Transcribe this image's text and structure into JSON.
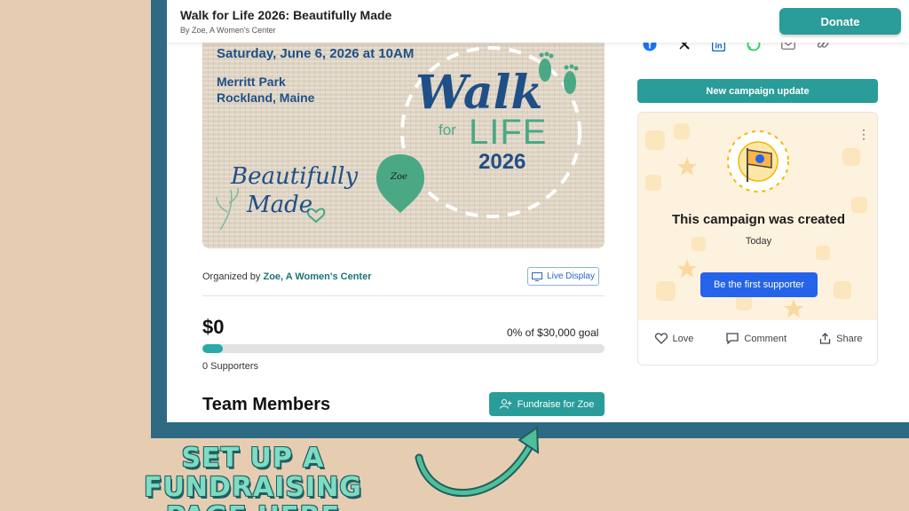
{
  "header": {
    "title": "Walk for Life 2026: Beautifully Made",
    "subtitle": "By Zoe, A Women's Center",
    "donate_label": "Donate"
  },
  "hero": {
    "date": "Saturday, June 6, 2026 at 10AM",
    "location_line1": "Merritt Park",
    "location_line2": "Rockland, Maine",
    "walk": "Walk",
    "for": "for",
    "life": "LIFE",
    "year": "2026",
    "beautifully": "Beautifully",
    "made": "Made",
    "pin_text": "Zoe"
  },
  "organizer": {
    "prefix": "Organized by ",
    "name": "Zoe, A Women's Center",
    "live_display_label": "Live Display"
  },
  "stats": {
    "raised": "$0",
    "goal_text": "0% of $30,000 goal",
    "progress_fraction": 0.05,
    "supporters": "0 Supporters"
  },
  "team": {
    "title": "Team Members",
    "fundraise_label": "Fundraise for Zoe"
  },
  "sidebar": {
    "share_icons": [
      "facebook-icon",
      "x-icon",
      "linkedin-icon",
      "whatsapp-icon",
      "email-icon",
      "link-icon"
    ],
    "update_label": "New campaign update",
    "card": {
      "title": "This campaign was created",
      "date": "Today",
      "cta_label": "Be the first supporter",
      "love_label": "Love",
      "comment_label": "Comment",
      "share_label": "Share"
    }
  },
  "promo": {
    "line1": "SET UP A FUNDRAISING",
    "line2": "PAGE HERE"
  },
  "colors": {
    "teal": "#2a9c99",
    "navy": "#1f4f86",
    "green": "#4aa885",
    "frame": "#2e6a83",
    "background": "#e6cdb2",
    "blue_button": "#2563eb"
  }
}
